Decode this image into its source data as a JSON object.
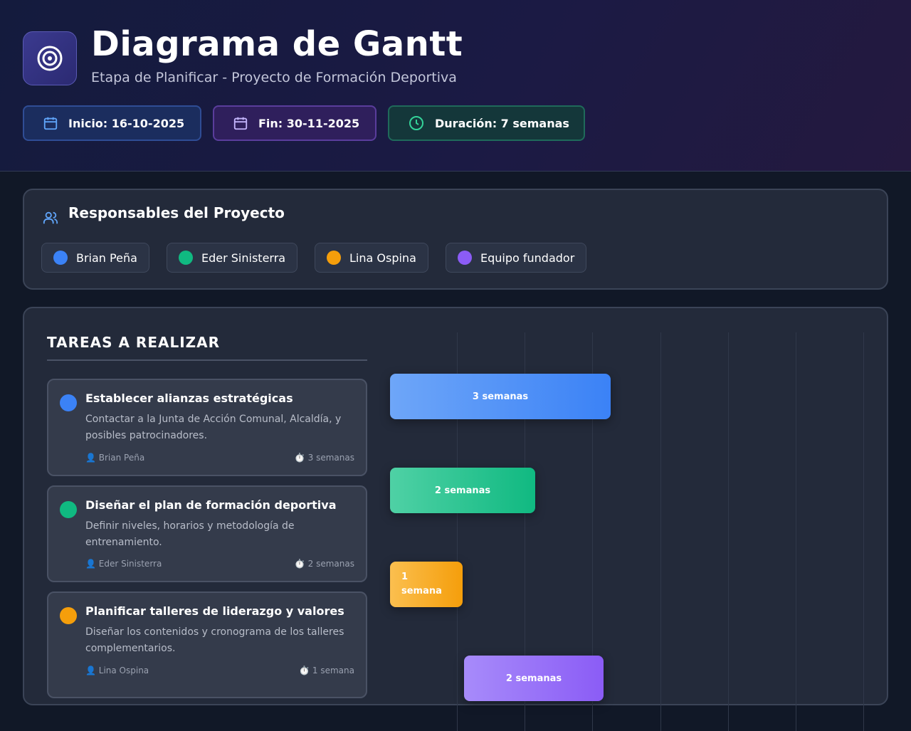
{
  "header": {
    "title": "Diagrama de Gantt",
    "subtitle": "Etapa de Planificar - Proyecto de Formación Deportiva",
    "logo_icon": "target-icon",
    "start_label": "Inicio: 16-10-2025",
    "end_label": "Fin: 30-11-2025",
    "duration_label": "Duración: 7 semanas"
  },
  "team": {
    "title": "Responsables del Proyecto",
    "members": [
      {
        "name": "Brian Peña",
        "color": "#3b82f6"
      },
      {
        "name": "Eder Sinisterra",
        "color": "#10b981"
      },
      {
        "name": "Lina Ospina",
        "color": "#f59e0b"
      },
      {
        "name": "Equipo fundador",
        "color": "#8b5cf6"
      }
    ]
  },
  "tasks_section": {
    "title": "TAREAS A REALIZAR",
    "tasks": [
      {
        "name": "Establecer alianzas estratégicas",
        "description": "Contactar a la Junta de Acción Comunal, Alcaldía, y posibles patrocinadores.",
        "owner": "👤 Brian Peña",
        "duration": "⏱️ 3 semanas",
        "bar_label": "3 semanas",
        "color": "#3b82f6"
      },
      {
        "name": "Diseñar el plan de formación deportiva",
        "description": "Definir niveles, horarios y metodología de entrenamiento.",
        "owner": "👤 Eder Sinisterra",
        "duration": "⏱️ 2 semanas",
        "bar_label": "2 semanas",
        "color": "#10b981"
      },
      {
        "name": "Planificar talleres de liderazgo y valores",
        "description": "Diseñar los contenidos y cronograma de los talleres complementarios.",
        "owner": "👤 Lina Ospina",
        "duration": "⏱️ 1 semana",
        "bar_label": "1 semana",
        "color": "#f59e0b"
      },
      {
        "bar_label": "2 semanas",
        "color": "#8b5cf6"
      }
    ]
  }
}
